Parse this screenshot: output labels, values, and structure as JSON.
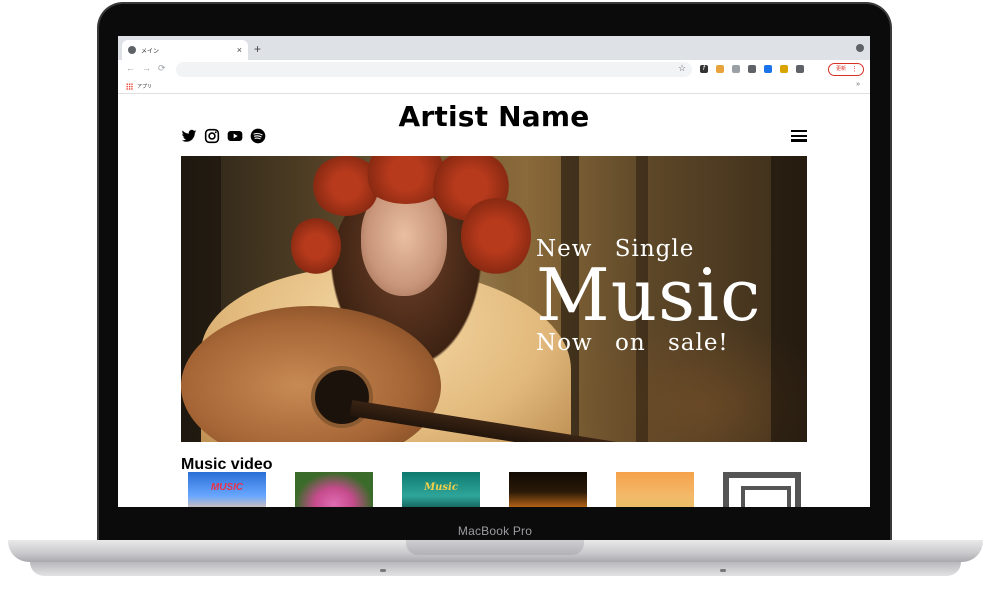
{
  "device": {
    "chin_label": "MacBook Pro"
  },
  "browser": {
    "tab_title": "メイン",
    "tab_close": "×",
    "new_tab": "+",
    "bookmark_apps_label": "アプリ",
    "bookmarks_more": "»",
    "update_label": "更新",
    "menu_dots": "⋮",
    "nav": {
      "back": "←",
      "forward": "→",
      "reload": "⟳"
    },
    "star": "☆"
  },
  "site": {
    "artist_name": "Artist Name",
    "social_icons": [
      "twitter-icon",
      "instagram-icon",
      "youtube-icon",
      "spotify-icon"
    ],
    "hero": {
      "line1": "New Single",
      "line2": "Music",
      "line3": "Now on sale!"
    },
    "music_video": {
      "heading": "Music video",
      "thumbnails": [
        {
          "label": "MUSIC",
          "colors": [
            "#d8314a",
            "#2a6fd6"
          ]
        },
        {
          "label": "",
          "colors": [
            "#c54b8c",
            "#3b6b2a"
          ]
        },
        {
          "label": "Music",
          "colors": [
            "#0e7a6e",
            "#f2d04a"
          ]
        },
        {
          "label": "",
          "colors": [
            "#2a1a08",
            "#e07a1a"
          ]
        },
        {
          "label": "",
          "colors": [
            "#f5a24a",
            "#e8c065"
          ]
        },
        {
          "label": "",
          "colors": [
            "#ffffff",
            "#555555"
          ]
        }
      ]
    }
  }
}
